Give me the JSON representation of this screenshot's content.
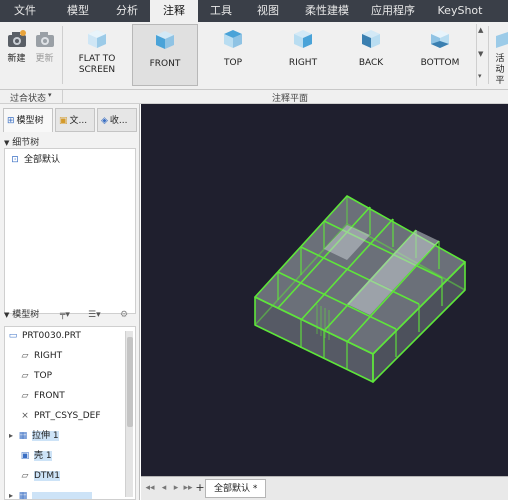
{
  "menubar": {
    "tabs": [
      {
        "label": "文件",
        "active": false
      },
      {
        "label": "模型",
        "active": false
      },
      {
        "label": "分析",
        "active": false
      },
      {
        "label": "注释",
        "active": true
      },
      {
        "label": "工具",
        "active": false
      },
      {
        "label": "视图",
        "active": false
      },
      {
        "label": "柔性建模",
        "active": false
      },
      {
        "label": "应用程序",
        "active": false
      },
      {
        "label": "KeyShot",
        "active": false
      }
    ]
  },
  "ribbon": {
    "new_label": "新建",
    "update_label": "更新",
    "views": [
      {
        "label_line1": "FLAT TO",
        "label_line2": "SCREEN",
        "active": false
      },
      {
        "label_line1": "FRONT",
        "label_line2": "",
        "active": true
      },
      {
        "label_line1": "TOP",
        "label_line2": "",
        "active": false
      },
      {
        "label_line1": "RIGHT",
        "label_line2": "",
        "active": false
      },
      {
        "label_line1": "BACK",
        "label_line2": "",
        "active": false
      },
      {
        "label_line1": "BOTTOM",
        "label_line2": "",
        "active": false
      }
    ],
    "right_cut_label": "活动",
    "right_cut_label2": "平",
    "group_state_label": "过合状态",
    "group_plane_label": "注释平面"
  },
  "left_panel": {
    "tabs": [
      "模型树",
      "文...",
      "收..."
    ],
    "detail_header": "细节树",
    "detail_items": [
      "全部默认"
    ],
    "model_header": "模型树",
    "model_items": [
      {
        "label": "PRT0030.PRT",
        "icon": "part-icon",
        "selected": false,
        "expander": ""
      },
      {
        "label": "RIGHT",
        "icon": "datum-plane-icon",
        "selected": false,
        "expander": ""
      },
      {
        "label": "TOP",
        "icon": "datum-plane-icon",
        "selected": false,
        "expander": ""
      },
      {
        "label": "FRONT",
        "icon": "datum-plane-icon",
        "selected": false,
        "expander": ""
      },
      {
        "label": "PRT_CSYS_DEF",
        "icon": "csys-icon",
        "selected": false,
        "expander": ""
      },
      {
        "label": "拉伸 1",
        "icon": "extrude-icon",
        "selected": true,
        "expander": "▸"
      },
      {
        "label": "壳 1",
        "icon": "shell-icon",
        "selected": true,
        "expander": ""
      },
      {
        "label": "DTM1",
        "icon": "datum-plane-icon",
        "selected": true,
        "expander": ""
      }
    ]
  },
  "bottom": {
    "sheet_label": "全部默认 *",
    "add_sheet": "+"
  },
  "colors": {
    "menubar_bg": "#3a3f48",
    "viewport_bg": "#1f1f2e",
    "model_edge": "#5ee63a",
    "model_face": "#a9b2b8",
    "selection_bg": "#cde3f7"
  }
}
